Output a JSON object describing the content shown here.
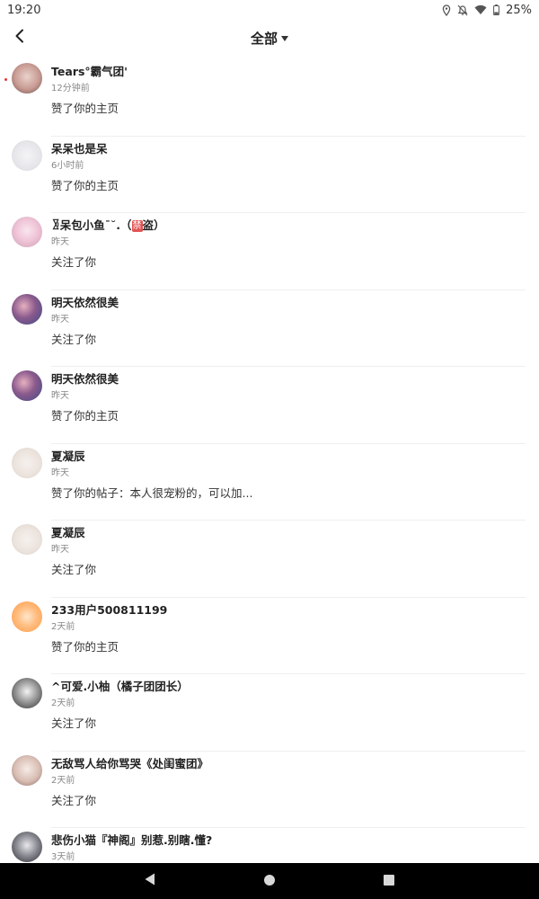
{
  "status_bar": {
    "time": "19:20",
    "battery": "25%",
    "icons": [
      "location-icon",
      "mute-icon",
      "wifi-icon",
      "battery-icon"
    ]
  },
  "header": {
    "back_icon": "chevron-left-icon",
    "filter_label": "全部",
    "filter_icon": "caret-down-icon"
  },
  "colors": {
    "primary_text": "#222222",
    "secondary_text": "#888888",
    "divider": "#efefef",
    "unread_dot": "#e33333",
    "ban_tag": "#e25555",
    "nav_bar": "#000000"
  },
  "notifications": [
    {
      "nickname": "Tears°霸气团'",
      "time": "12分钟前",
      "action": "赞了你的主页",
      "unread": true
    },
    {
      "nickname": "呆呆也是呆",
      "time": "6小时前",
      "action": "赞了你的主页"
    },
    {
      "nickname": "ꂣ呆包小鱼ˉ˘.（",
      "tag": "禁",
      "nickname_tail": "盗）",
      "time": "昨天",
      "action": "关注了你"
    },
    {
      "nickname": "明天依然很美",
      "time": "昨天",
      "action": "关注了你"
    },
    {
      "nickname": "明天依然很美",
      "time": "昨天",
      "action": "赞了你的主页"
    },
    {
      "nickname": "夏凝辰",
      "time": "昨天",
      "action": "赞了你的帖子：本人很宠粉的，可以加..."
    },
    {
      "nickname": "夏凝辰",
      "time": "昨天",
      "action": "关注了你"
    },
    {
      "nickname": "233用户500811199",
      "time": "2天前",
      "action": "赞了你的主页"
    },
    {
      "nickname": "^可爱.小柚（橘子团团长）",
      "time": "2天前",
      "action": "关注了你"
    },
    {
      "nickname": "无敌骂人给你骂哭《处闺蜜团》",
      "time": "2天前",
      "action": "关注了你"
    },
    {
      "nickname": "悲伤小猫『神阁』别惹.别瞎.懂?",
      "time": "3天前",
      "action": ""
    }
  ],
  "nav_bar": {
    "buttons": [
      "back-triangle-icon",
      "home-circle-icon",
      "recents-square-icon"
    ]
  }
}
